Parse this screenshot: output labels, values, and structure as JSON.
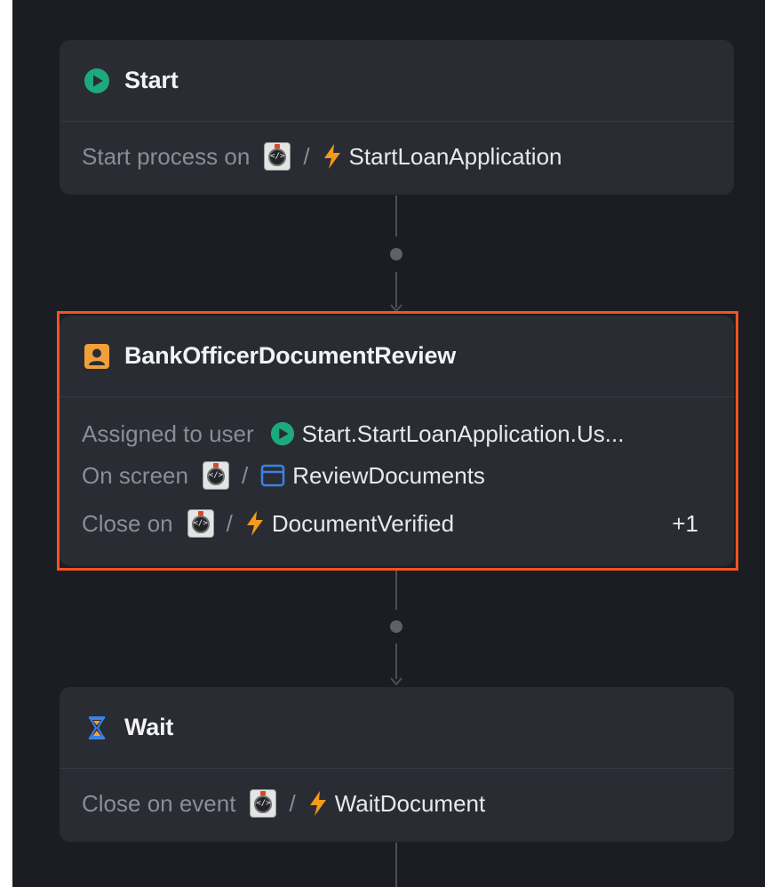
{
  "start_node": {
    "title": "Start",
    "icon": "play-icon",
    "row_label": "Start process on",
    "separator": "/",
    "event": "StartLoanApplication"
  },
  "review_node": {
    "title": "BankOfficerDocumentReview",
    "icon": "user-icon",
    "assigned_label": "Assigned to user",
    "assigned_value": "Start.StartLoanApplication.Us...",
    "screen_label": "On screen",
    "separator": "/",
    "screen_value": "ReviewDocuments",
    "close_label": "Close on",
    "close_event": "DocumentVerified",
    "extra_count": "+1",
    "selected": true
  },
  "wait_node": {
    "title": "Wait",
    "icon": "hourglass-icon",
    "close_label": "Close on event",
    "separator": "/",
    "event": "WaitDocument"
  },
  "colors": {
    "canvas": "#1c1d22",
    "card": "#2a2c33",
    "selection": "#f25223",
    "start_green": "#1ea97c",
    "user_orange": "#f0a03a",
    "bolt": "#f59a1c",
    "screen_blue": "#3b82e6"
  }
}
